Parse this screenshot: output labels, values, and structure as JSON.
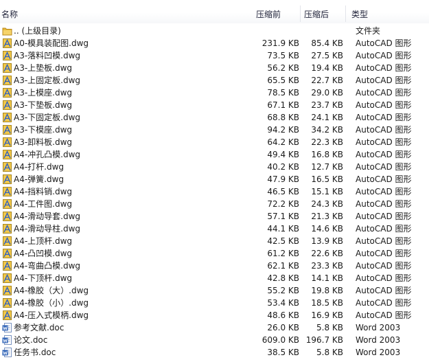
{
  "columns": {
    "name": "名称",
    "before": "压缩前",
    "after": "压缩后",
    "type": "类型"
  },
  "rows": [
    {
      "icon": "folder-icon",
      "name": ".. (上级目录)",
      "before": "",
      "after": "",
      "type": "文件夹"
    },
    {
      "icon": "autocad-file-icon",
      "name": "A0-模具装配图.dwg",
      "before": "231.9 KB",
      "after": "85.4 KB",
      "type": "AutoCAD 图形"
    },
    {
      "icon": "autocad-file-icon",
      "name": "A3-落料凹模.dwg",
      "before": "73.5 KB",
      "after": "27.5 KB",
      "type": "AutoCAD 图形"
    },
    {
      "icon": "autocad-file-icon",
      "name": "A3-上垫板.dwg",
      "before": "56.2 KB",
      "after": "19.4 KB",
      "type": "AutoCAD 图形"
    },
    {
      "icon": "autocad-file-icon",
      "name": "A3-上固定板.dwg",
      "before": "65.5 KB",
      "after": "22.7 KB",
      "type": "AutoCAD 图形"
    },
    {
      "icon": "autocad-file-icon",
      "name": "A3-上模座.dwg",
      "before": "78.5 KB",
      "after": "29.0 KB",
      "type": "AutoCAD 图形"
    },
    {
      "icon": "autocad-file-icon",
      "name": "A3-下垫板.dwg",
      "before": "67.1 KB",
      "after": "23.7 KB",
      "type": "AutoCAD 图形"
    },
    {
      "icon": "autocad-file-icon",
      "name": "A3-下固定板.dwg",
      "before": "68.8 KB",
      "after": "24.1 KB",
      "type": "AutoCAD 图形"
    },
    {
      "icon": "autocad-file-icon",
      "name": "A3-下模座.dwg",
      "before": "94.2 KB",
      "after": "34.2 KB",
      "type": "AutoCAD 图形"
    },
    {
      "icon": "autocad-file-icon",
      "name": "A3-卸料板.dwg",
      "before": "64.2 KB",
      "after": "22.3 KB",
      "type": "AutoCAD 图形"
    },
    {
      "icon": "autocad-file-icon",
      "name": "A4-冲孔凸模.dwg",
      "before": "49.4 KB",
      "after": "16.8 KB",
      "type": "AutoCAD 图形"
    },
    {
      "icon": "autocad-file-icon",
      "name": "A4-打杆.dwg",
      "before": "40.2 KB",
      "after": "12.7 KB",
      "type": "AutoCAD 图形"
    },
    {
      "icon": "autocad-file-icon",
      "name": "A4-弹簧.dwg",
      "before": "47.9 KB",
      "after": "16.5 KB",
      "type": "AutoCAD 图形"
    },
    {
      "icon": "autocad-file-icon",
      "name": "A4-挡料销.dwg",
      "before": "46.5 KB",
      "after": "15.1 KB",
      "type": "AutoCAD 图形"
    },
    {
      "icon": "autocad-file-icon",
      "name": "A4-工件图.dwg",
      "before": "72.2 KB",
      "after": "24.3 KB",
      "type": "AutoCAD 图形"
    },
    {
      "icon": "autocad-file-icon",
      "name": "A4-滑动导套.dwg",
      "before": "57.1 KB",
      "after": "21.3 KB",
      "type": "AutoCAD 图形"
    },
    {
      "icon": "autocad-file-icon",
      "name": "A4-滑动导柱.dwg",
      "before": "44.1 KB",
      "after": "14.6 KB",
      "type": "AutoCAD 图形"
    },
    {
      "icon": "autocad-file-icon",
      "name": "A4-上顶杆.dwg",
      "before": "42.5 KB",
      "after": "13.9 KB",
      "type": "AutoCAD 图形"
    },
    {
      "icon": "autocad-file-icon",
      "name": "A4-凸凹模.dwg",
      "before": "61.2 KB",
      "after": "22.6 KB",
      "type": "AutoCAD 图形"
    },
    {
      "icon": "autocad-file-icon",
      "name": "A4-弯曲凸模.dwg",
      "before": "62.1 KB",
      "after": "23.3 KB",
      "type": "AutoCAD 图形"
    },
    {
      "icon": "autocad-file-icon",
      "name": "A4-下顶杆.dwg",
      "before": "42.8 KB",
      "after": "14.1 KB",
      "type": "AutoCAD 图形"
    },
    {
      "icon": "autocad-file-icon",
      "name": "A4-橡胶（大）.dwg",
      "before": "55.2 KB",
      "after": "19.8 KB",
      "type": "AutoCAD 图形"
    },
    {
      "icon": "autocad-file-icon",
      "name": "A4-橡胶（小）.dwg",
      "before": "53.4 KB",
      "after": "18.5 KB",
      "type": "AutoCAD 图形"
    },
    {
      "icon": "autocad-file-icon",
      "name": "A4-压入式模柄.dwg",
      "before": "48.6 KB",
      "after": "16.9 KB",
      "type": "AutoCAD 图形"
    },
    {
      "icon": "word-doc-icon",
      "name": "参考文献.doc",
      "before": "26.0 KB",
      "after": "5.8 KB",
      "type": "Word 2003"
    },
    {
      "icon": "word-doc-icon",
      "name": "论文.doc",
      "before": "609.0 KB",
      "after": "196.7 KB",
      "type": "Word 2003"
    },
    {
      "icon": "word-doc-icon",
      "name": "任务书.doc",
      "before": "38.5 KB",
      "after": "5.8 KB",
      "type": "Word 2003"
    }
  ],
  "colors": {
    "folder": "#e8b93c",
    "autocad_sheet": "#f1c84a",
    "autocad_accent": "#2c5fc4",
    "word_blue": "#2a5fb5"
  }
}
